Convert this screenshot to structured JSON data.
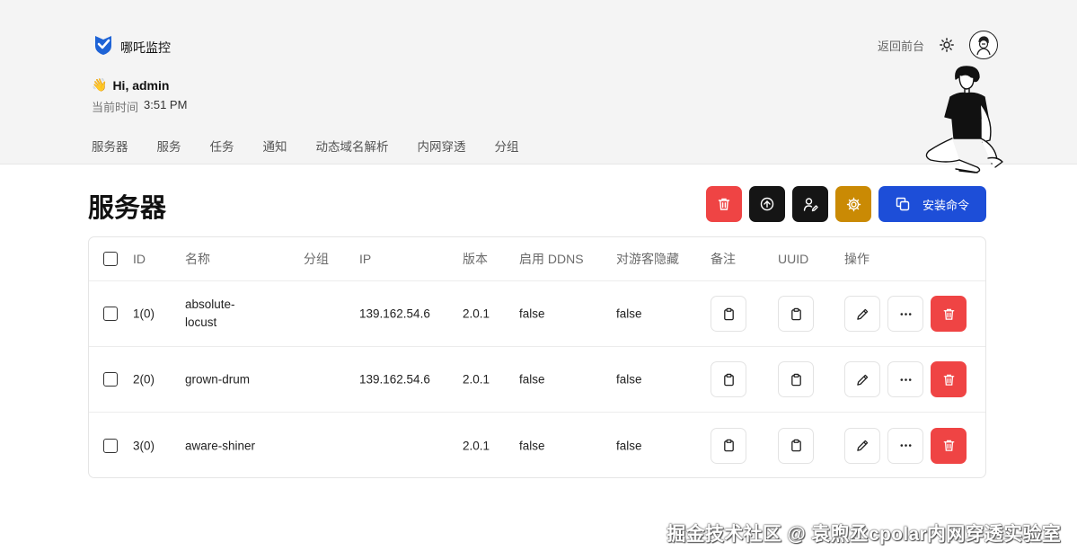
{
  "brand": {
    "name": "哪吒监控"
  },
  "topbar": {
    "back_label": "返回前台",
    "theme_icon": "sun-icon",
    "avatar_icon": "avatar-icon"
  },
  "greeting": {
    "emoji": "👋",
    "text": "Hi, admin",
    "time_label": "当前时间",
    "time_value": "3:51 PM"
  },
  "nav": {
    "items": [
      "服务器",
      "服务",
      "任务",
      "通知",
      "动态域名解析",
      "内网穿透",
      "分组"
    ]
  },
  "page": {
    "title": "服务器"
  },
  "toolbar": {
    "delete_icon": "trash-icon",
    "upgrade_icon": "arrow-up-circle-icon",
    "assign_icon": "user-edit-icon",
    "settings_icon": "gear-icon",
    "install_label": "安装命令",
    "colors": {
      "red": "#ef4444",
      "black": "#151515",
      "gold": "#ca8a04",
      "blue": "#1d4ed8"
    }
  },
  "table": {
    "columns": [
      "ID",
      "名称",
      "分组",
      "IP",
      "版本",
      "启用 DDNS",
      "对游客隐藏",
      "备注",
      "UUID",
      "操作"
    ],
    "rows": [
      {
        "id": "1(0)",
        "name": "absolute-locust",
        "group": "",
        "ip": "139.162.54.6",
        "version": "2.0.1",
        "ddns": "false",
        "hidden": "false"
      },
      {
        "id": "2(0)",
        "name": "grown-drum",
        "group": "",
        "ip": "139.162.54.6",
        "version": "2.0.1",
        "ddns": "false",
        "hidden": "false"
      },
      {
        "id": "3(0)",
        "name": "aware-shiner",
        "group": "",
        "ip": "",
        "version": "2.0.1",
        "ddns": "false",
        "hidden": "false"
      }
    ]
  },
  "watermark": {
    "text": "掘金技术社区 @ 袁煦丞cpolar内网穿透实验室"
  }
}
